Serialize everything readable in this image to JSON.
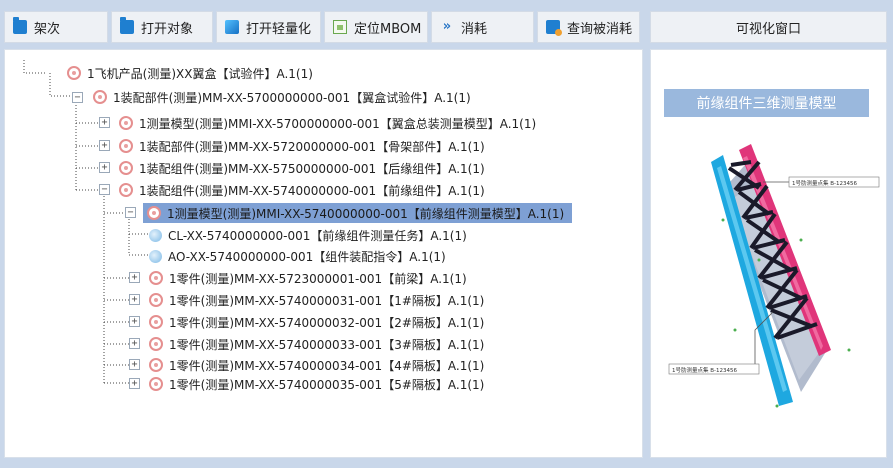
{
  "toolbar": {
    "items": [
      {
        "label": "架次",
        "icon": "folder-icon"
      },
      {
        "label": "打开对象",
        "icon": "folder-open-icon"
      },
      {
        "label": "打开轻量化",
        "icon": "cube-icon"
      },
      {
        "label": "定位MBOM",
        "icon": "locate-icon"
      },
      {
        "label": "消耗",
        "icon": "chevron-right-icon"
      },
      {
        "label": "查询被消耗",
        "icon": "query-icon"
      }
    ]
  },
  "viewer": {
    "header": "可视化窗口",
    "model_title": "前缘组件三维测量模型",
    "callout_top": "1号肋测量点集 B-123456",
    "callout_bottom": "1号肋测量点集 B-123456"
  },
  "tree": {
    "nodes": [
      {
        "text": "1飞机产品(测量)XX翼盒【试验件】A.1(1)",
        "icon": "part",
        "toggle": ""
      },
      {
        "text": "1装配部件(测量)MM-XX-5700000000-001【翼盒试验件】A.1(1)",
        "icon": "part",
        "toggle": "−"
      },
      {
        "text": "1测量模型(测量)MMI-XX-5700000000-001【翼盒总装测量模型】A.1(1)",
        "icon": "part",
        "toggle": "+"
      },
      {
        "text": "1装配部件(测量)MM-XX-5720000000-001【骨架部件】A.1(1)",
        "icon": "part",
        "toggle": "+"
      },
      {
        "text": "1装配组件(测量)MM-XX-5750000000-001【后缘组件】A.1(1)",
        "icon": "part",
        "toggle": "+"
      },
      {
        "text": "1装配组件(测量)MM-XX-5740000000-001【前缘组件】A.1(1)",
        "icon": "part",
        "toggle": "−"
      },
      {
        "text": "1测量模型(测量)MMI-XX-5740000000-001【前缘组件测量模型】A.1(1)",
        "icon": "part",
        "toggle": "−",
        "selected": true
      },
      {
        "text": "CL-XX-5740000000-001【前缘组件测量任务】A.1(1)",
        "icon": "doc",
        "toggle": ""
      },
      {
        "text": "AO-XX-5740000000-001【组件装配指令】A.1(1)",
        "icon": "doc",
        "toggle": ""
      },
      {
        "text": "1零件(测量)MM-XX-5723000001-001【前梁】A.1(1)",
        "icon": "part",
        "toggle": "+"
      },
      {
        "text": "1零件(测量)MM-XX-5740000031-001【1#隔板】A.1(1)",
        "icon": "part",
        "toggle": "+"
      },
      {
        "text": "1零件(测量)MM-XX-5740000032-001【2#隔板】A.1(1)",
        "icon": "part",
        "toggle": "+"
      },
      {
        "text": "1零件(测量)MM-XX-5740000033-001【3#隔板】A.1(1)",
        "icon": "part",
        "toggle": "+"
      },
      {
        "text": "1零件(测量)MM-XX-5740000034-001【4#隔板】A.1(1)",
        "icon": "part",
        "toggle": "+"
      },
      {
        "text": "1零件(测量)MM-XX-5740000035-001【5#隔板】A.1(1)",
        "icon": "part",
        "toggle": "+"
      }
    ]
  },
  "colors": {
    "background": "#c9d7ea",
    "selection": "#7ea0d4",
    "model_title_bg": "#9ab8dd",
    "frame_cyan": "#1ea8e0",
    "frame_magenta": "#e0357a",
    "frame_grey": "#a9b4c8"
  }
}
